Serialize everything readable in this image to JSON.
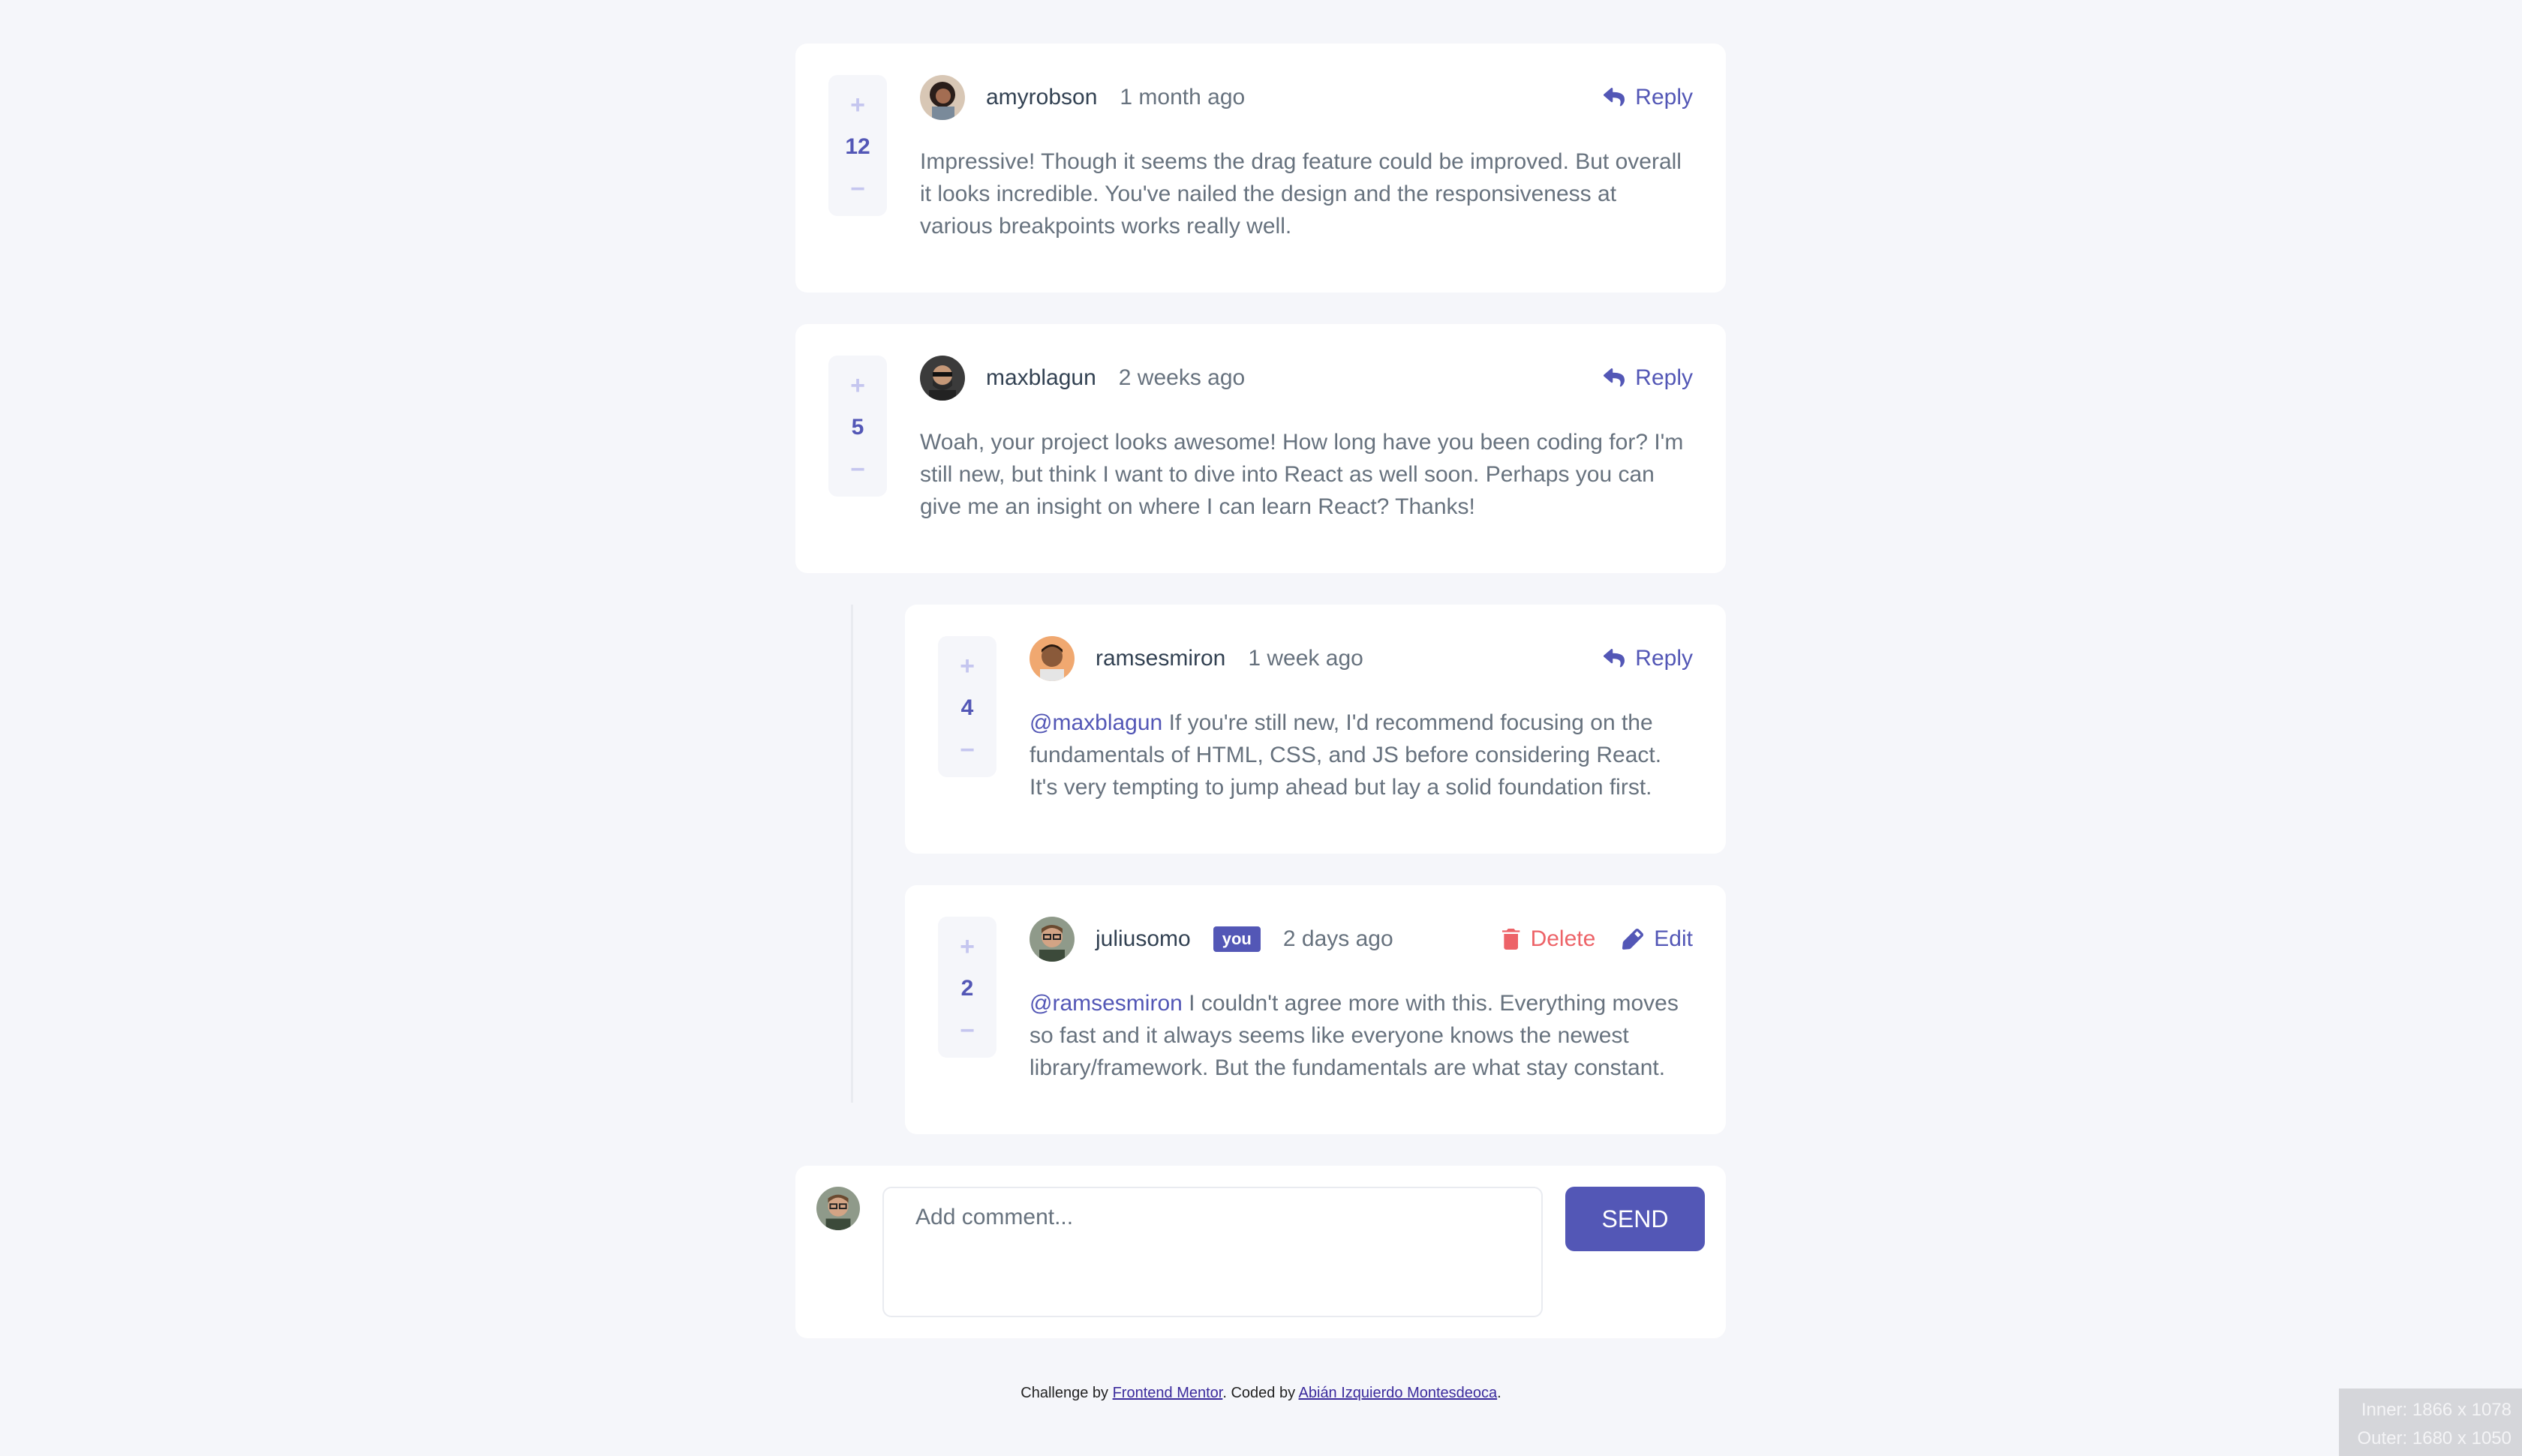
{
  "comments": [
    {
      "score": "12",
      "username": "amyrobson",
      "time": "1 month ago",
      "reply_label": "Reply",
      "text": "Impressive! Though it seems the drag feature could be improved. But overall it looks incredible. You've nailed the design and the responsiveness at various breakpoints works really well.",
      "avatar_icon": "avatar-amyrobson"
    },
    {
      "score": "5",
      "username": "maxblagun",
      "time": "2 weeks ago",
      "reply_label": "Reply",
      "text": "Woah, your project looks awesome! How long have you been coding for? I'm still new, but think I want to dive into React as well soon. Perhaps you can give me an insight on where I can learn React? Thanks!",
      "avatar_icon": "avatar-maxblagun"
    }
  ],
  "replies": [
    {
      "score": "4",
      "username": "ramsesmiron",
      "time": "1 week ago",
      "reply_label": "Reply",
      "mention": "@maxblagun",
      "text": "If you're still new, I'd recommend focusing on the fundamentals of HTML, CSS, and JS before considering React. It's very tempting to jump ahead but lay a solid foundation first.",
      "avatar_icon": "avatar-ramsesmiron"
    },
    {
      "score": "2",
      "username": "juliusomo",
      "badge": "you",
      "time": "2 days ago",
      "delete_label": "Delete",
      "edit_label": "Edit",
      "mention": "@ramsesmiron",
      "text": "I couldn't agree more with this. Everything moves so fast and it always seems like everyone knows the newest library/framework. But the fundamentals are what stay constant.",
      "avatar_icon": "avatar-juliusomo"
    }
  ],
  "composer": {
    "placeholder": "Add comment...",
    "send_label": "SEND"
  },
  "footer": {
    "prefix": "Challenge by ",
    "link1": "Frontend Mentor",
    "middle": ". Coded by ",
    "link2": "Abián Izquierdo Montesdeoca",
    "suffix": "."
  },
  "viewport": {
    "inner": "Inner: 1866 x 1078",
    "outer": "Outer: 1680 x 1050"
  },
  "colors": {
    "accent": "#5357b6",
    "danger": "#ed6368",
    "vote_muted": "#c5c6ef",
    "background": "#f5f6fa"
  }
}
